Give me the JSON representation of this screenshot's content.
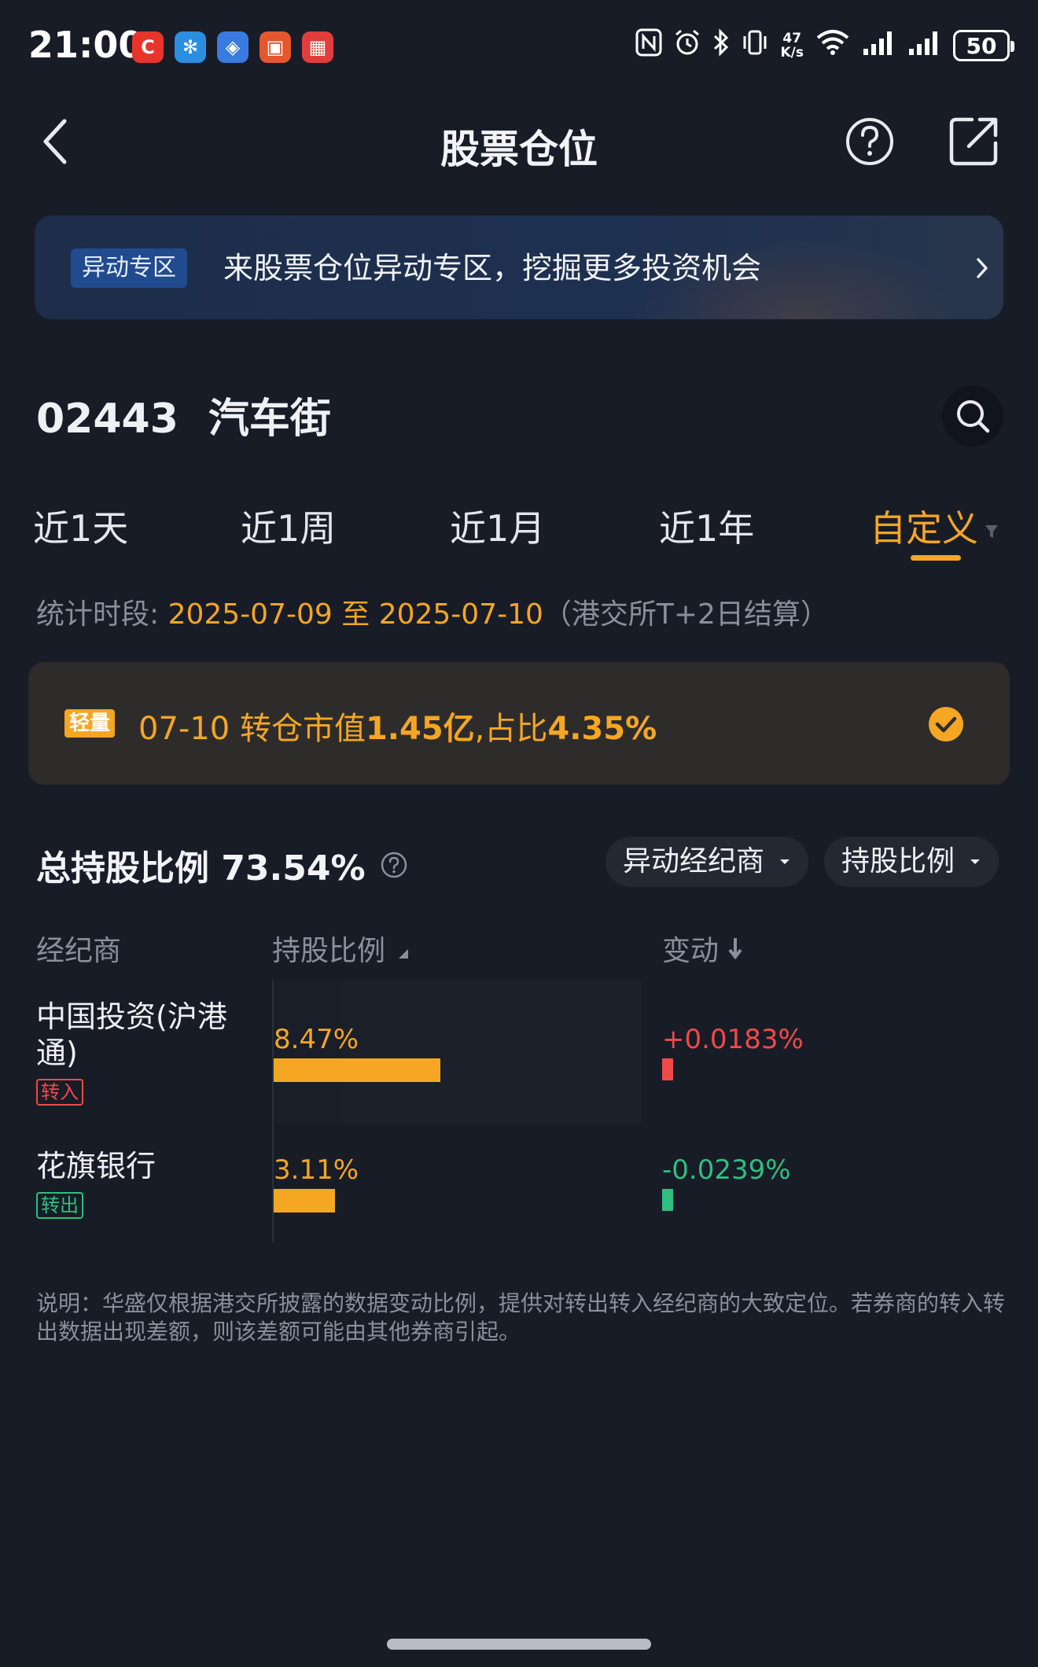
{
  "status_bar": {
    "time": "21:00",
    "apps": [
      {
        "icon": "c-app-icon",
        "glyph": "C",
        "color": "#e8352c"
      },
      {
        "icon": "tplink-app-icon",
        "glyph": "✻",
        "color": "#2a8fe0"
      },
      {
        "icon": "shield-app-icon",
        "glyph": "◈",
        "color": "#3a7be0"
      },
      {
        "icon": "tv-app-icon",
        "glyph": "▣",
        "color": "#e4572e"
      },
      {
        "icon": "store-app-icon",
        "glyph": "▦",
        "color": "#e23d3d"
      }
    ],
    "net_speed_top": "47",
    "net_speed_bottom": "K/s",
    "battery": "50"
  },
  "header": {
    "title": "股票仓位"
  },
  "banner": {
    "badge": "异动专区",
    "text": "来股票仓位异动专区，挖掘更多投资机会"
  },
  "stock": {
    "code": "02443",
    "name": "汽车街"
  },
  "tabs": [
    "近1天",
    "近1周",
    "近1月",
    "近1年",
    "自定义"
  ],
  "active_tab": "自定义",
  "period": {
    "label": "统计时段: ",
    "start": "2025-07-09",
    "sep": " 至 ",
    "end": "2025-07-10",
    "suffix": "（港交所T+2日结算）"
  },
  "alert": {
    "badge": "轻量",
    "date": "07-10",
    "text_a": " 转仓市值",
    "value_a": "1.45亿",
    "text_b": ",占比",
    "value_b": "4.35%"
  },
  "total": {
    "label": "总持股比例 73.54%"
  },
  "filters": {
    "broker_filter": "异动经纪商",
    "sort_filter": "持股比例"
  },
  "table": {
    "col_broker": "经纪商",
    "col_ratio": "持股比例",
    "col_change": "变动",
    "rows": [
      {
        "name": "中国投资(沪港通)",
        "tag": "转入",
        "ratio": "8.47%",
        "ratio_value": 8.47,
        "change": "+0.0183%",
        "direction": "up"
      },
      {
        "name": "花旗银行",
        "tag": "转出",
        "ratio": "3.11%",
        "ratio_value": 3.11,
        "change": "-0.0239%",
        "direction": "down"
      }
    ]
  },
  "note": "说明：华盛仅根据港交所披露的数据变动比例，提供对转出转入经纪商的大致定位。若券商的转入转出数据出现差额，则该差额可能由其他券商引起。",
  "colors": {
    "accent": "#f5a623",
    "up": "#ef4a47",
    "down": "#2fbf7e",
    "background": "#181c27"
  }
}
